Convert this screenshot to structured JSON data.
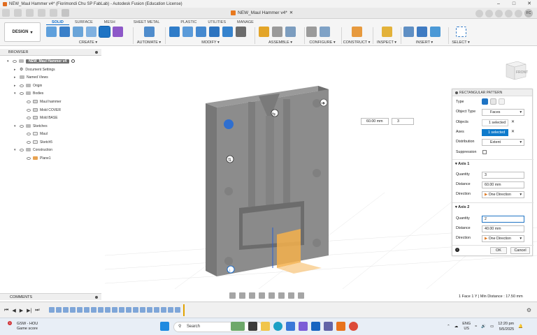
{
  "window": {
    "title": "NEW_Maul Hammer v4* (Fiorimondi Chu SP FabLab) - Autodesk Fusion (Education License)"
  },
  "tabbar": {
    "document_tab": "NEW_Maul Hammer v4*",
    "avatar_initials": "FC"
  },
  "ribbon": {
    "design_button": "DESIGN",
    "tabs": [
      "SOLID",
      "SURFACE",
      "MESH",
      "SHEET METAL",
      "PLASTIC",
      "UTILITIES",
      "MANAGE"
    ],
    "active_tab": "SOLID",
    "groups": [
      "CREATE",
      "AUTOMATE",
      "MODIFY",
      "ASSEMBLE",
      "CONFIGURE",
      "CONSTRUCT",
      "INSPECT",
      "INSERT",
      "SELECT"
    ]
  },
  "browser": {
    "title": "BROWSER",
    "root": "NEW_Maul Hammer v4",
    "items": [
      {
        "label": "Document Settings"
      },
      {
        "label": "Named Views"
      },
      {
        "label": "Origin"
      },
      {
        "label": "Bodies"
      },
      {
        "label": "Maul hammer"
      },
      {
        "label": "Mold COVER"
      },
      {
        "label": "Mold BASE"
      },
      {
        "label": "Sketches"
      },
      {
        "label": "Maul"
      },
      {
        "label": "Sketch5"
      },
      {
        "label": "Construction"
      },
      {
        "label": "Plane1"
      }
    ]
  },
  "canvas": {
    "distance_value": "60.00 mm",
    "quantity_value": "3"
  },
  "viewcube": {
    "label": "FRONT"
  },
  "pattern_panel": {
    "title": "RECTANGULAR PATTERN",
    "type_label": "Type",
    "object_type_label": "Object Type",
    "object_type_value": "Faces",
    "objects_label": "Objects",
    "objects_value": "1 selected",
    "axes_label": "Axes",
    "axes_value": "1 selected",
    "distribution_label": "Distribution",
    "distribution_value": "Extent",
    "suppression_label": "Suppression",
    "axis1": {
      "title": "Axis 1",
      "quantity_label": "Quantity",
      "quantity_value": "3",
      "distance_label": "Distance",
      "distance_value": "60.00 mm",
      "direction_label": "Direction",
      "direction_value": "One Direction"
    },
    "axis2": {
      "title": "Axis 2",
      "quantity_label": "Quantity",
      "quantity_value": "2",
      "distance_label": "Distance",
      "distance_value": "40.00 mm",
      "direction_label": "Direction",
      "direction_value": "One Direction"
    },
    "ok_label": "OK",
    "cancel_label": "Cancel"
  },
  "comments": {
    "title": "COMMENTS"
  },
  "status": {
    "text": "1 Face 1 Y | Min Distance : 17.50 mm"
  },
  "taskbar": {
    "weather_title": "GSW - HOU",
    "weather_sub": "Game score",
    "search_placeholder": "Search",
    "lang_top": "ENG",
    "lang_bottom": "US",
    "time": "12:20 pm",
    "date": "5/5/2025"
  }
}
